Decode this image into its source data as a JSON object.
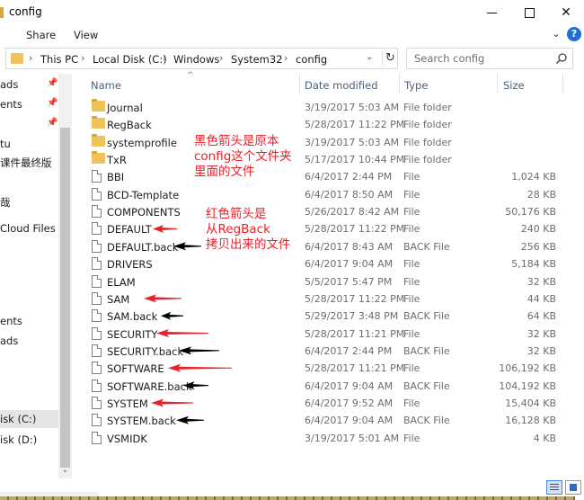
{
  "window": {
    "title": "config",
    "minimize_glyph": "",
    "close_glyph": "✕"
  },
  "ribbon": {
    "tabs": [
      "Share",
      "View"
    ],
    "expand_glyph": "⌄",
    "help_glyph": "?"
  },
  "address": {
    "crumbs": [
      "This PC",
      "Local Disk (C:)",
      "Windows",
      "System32",
      "config"
    ],
    "separator": "›",
    "dropdown_glyph": "⌄",
    "refresh_glyph": "↻"
  },
  "search": {
    "placeholder": "Search config"
  },
  "nav": {
    "items": [
      {
        "label": "ads",
        "pinned": true
      },
      {
        "label": "ents",
        "pinned": true
      },
      {
        "label": "",
        "pinned": true
      },
      {
        "label": "tu",
        "pinned": false
      },
      {
        "label": "课件最终版",
        "pinned": false
      },
      {
        "label": "哉",
        "pinned": false
      },
      {
        "label": "Cloud Files",
        "pinned": false
      },
      {
        "label": "ents",
        "pinned": false
      },
      {
        "label": "ads",
        "pinned": false
      },
      {
        "label": "isk (C:)",
        "pinned": false,
        "selected": true
      },
      {
        "label": "isk (D:)",
        "pinned": false
      }
    ],
    "scroll_down_glyph": "⌄"
  },
  "columns": {
    "name": "Name",
    "date": "Date modified",
    "type": "Type",
    "size": "Size"
  },
  "files": [
    {
      "name": "Journal",
      "date": "3/19/2017 5:03 AM",
      "type": "File folder",
      "size": "",
      "kind": "folder"
    },
    {
      "name": "RegBack",
      "date": "5/28/2017 11:22 PM",
      "type": "File folder",
      "size": "",
      "kind": "folder"
    },
    {
      "name": "systemprofile",
      "date": "3/19/2017 5:03 AM",
      "type": "File folder",
      "size": "",
      "kind": "folder"
    },
    {
      "name": "TxR",
      "date": "5/17/2017 10:44 PM",
      "type": "File folder",
      "size": "",
      "kind": "folder"
    },
    {
      "name": "BBI",
      "date": "6/4/2017 2:44 PM",
      "type": "File",
      "size": "1,024 KB",
      "kind": "file"
    },
    {
      "name": "BCD-Template",
      "date": "6/4/2017 8:50 AM",
      "type": "File",
      "size": "28 KB",
      "kind": "file"
    },
    {
      "name": "COMPONENTS",
      "date": "5/26/2017 8:42 AM",
      "type": "File",
      "size": "50,176 KB",
      "kind": "file"
    },
    {
      "name": "DEFAULT",
      "date": "5/28/2017 11:22 PM",
      "type": "File",
      "size": "240 KB",
      "kind": "file"
    },
    {
      "name": "DEFAULT.back",
      "date": "6/4/2017 8:43 AM",
      "type": "BACK File",
      "size": "256 KB",
      "kind": "file"
    },
    {
      "name": "DRIVERS",
      "date": "6/4/2017 9:04 AM",
      "type": "File",
      "size": "5,184 KB",
      "kind": "file"
    },
    {
      "name": "ELAM",
      "date": "5/5/2017 5:47 PM",
      "type": "File",
      "size": "32 KB",
      "kind": "file"
    },
    {
      "name": "SAM",
      "date": "5/28/2017 11:22 PM",
      "type": "File",
      "size": "44 KB",
      "kind": "file"
    },
    {
      "name": "SAM.back",
      "date": "5/29/2017 3:48 PM",
      "type": "BACK File",
      "size": "64 KB",
      "kind": "file"
    },
    {
      "name": "SECURITY",
      "date": "5/28/2017 11:21 PM",
      "type": "File",
      "size": "32 KB",
      "kind": "file"
    },
    {
      "name": "SECURITY.back",
      "date": "6/4/2017 2:44 PM",
      "type": "BACK File",
      "size": "32 KB",
      "kind": "file"
    },
    {
      "name": "SOFTWARE",
      "date": "5/28/2017 11:21 PM",
      "type": "File",
      "size": "106,192 KB",
      "kind": "file"
    },
    {
      "name": "SOFTWARE.back",
      "date": "6/4/2017 9:04 AM",
      "type": "BACK File",
      "size": "104,192 KB",
      "kind": "file"
    },
    {
      "name": "SYSTEM",
      "date": "6/4/2017 9:52 AM",
      "type": "File",
      "size": "15,404 KB",
      "kind": "file"
    },
    {
      "name": "SYSTEM.back",
      "date": "6/4/2017 9:04 AM",
      "type": "BACK File",
      "size": "16,128 KB",
      "kind": "file"
    },
    {
      "name": "VSMIDK",
      "date": "3/19/2017 5:01 AM",
      "type": "File",
      "size": "4 KB",
      "kind": "file"
    }
  ],
  "annotations": {
    "note_black_arrows": [
      "黑色箭头是原本",
      "config这个文件夹",
      "里面的文件"
    ],
    "note_red_arrows": [
      "红色箭头是",
      "从RegBack",
      "拷贝出来的文件"
    ],
    "red_arrow_color": "#e8212b",
    "black_arrow_color": "#000000"
  }
}
